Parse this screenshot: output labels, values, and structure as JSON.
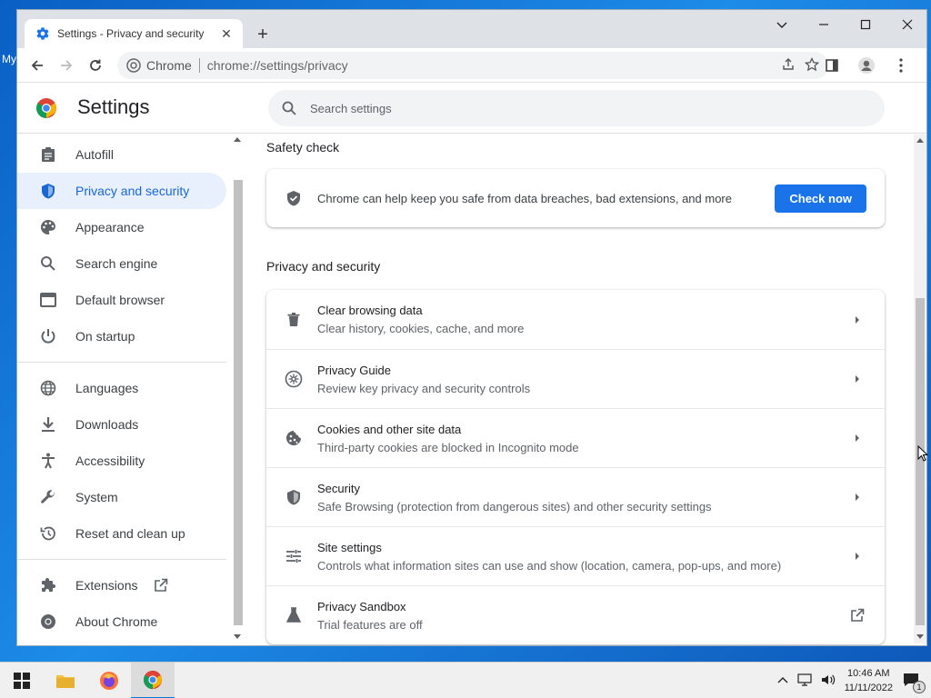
{
  "desktop": {
    "icon_label": "My"
  },
  "tab": {
    "title": "Settings - Privacy and security",
    "close": "✕"
  },
  "newtab_label": "+",
  "omnibox": {
    "site_name": "Chrome",
    "url": "chrome://settings/privacy"
  },
  "header": {
    "title": "Settings",
    "search_placeholder": "Search settings"
  },
  "sidebar": {
    "items": [
      {
        "label": "Autofill",
        "icon": "clipboard-icon"
      },
      {
        "label": "Privacy and security",
        "icon": "shield-icon",
        "active": true
      },
      {
        "label": "Appearance",
        "icon": "palette-icon"
      },
      {
        "label": "Search engine",
        "icon": "search-icon"
      },
      {
        "label": "Default browser",
        "icon": "browser-icon"
      },
      {
        "label": "On startup",
        "icon": "power-icon"
      },
      {
        "label": "Languages",
        "icon": "globe-icon"
      },
      {
        "label": "Downloads",
        "icon": "download-icon"
      },
      {
        "label": "Accessibility",
        "icon": "accessibility-icon"
      },
      {
        "label": "System",
        "icon": "wrench-icon"
      },
      {
        "label": "Reset and clean up",
        "icon": "history-icon"
      },
      {
        "label": "Extensions",
        "icon": "puzzle-icon"
      },
      {
        "label": "About Chrome",
        "icon": "chrome-icon"
      }
    ]
  },
  "safety_check": {
    "title": "Safety check",
    "text": "Chrome can help keep you safe from data breaches, bad extensions, and more",
    "button": "Check now"
  },
  "privacy": {
    "title": "Privacy and security",
    "rows": [
      {
        "title": "Clear browsing data",
        "subtitle": "Clear history, cookies, cache, and more",
        "icon": "trash-icon"
      },
      {
        "title": "Privacy Guide",
        "subtitle": "Review key privacy and security controls",
        "icon": "privacy-guide-icon"
      },
      {
        "title": "Cookies and other site data",
        "subtitle": "Third-party cookies are blocked in Incognito mode",
        "icon": "cookie-icon"
      },
      {
        "title": "Security",
        "subtitle": "Safe Browsing (protection from dangerous sites) and other security settings",
        "icon": "shield-icon"
      },
      {
        "title": "Site settings",
        "subtitle": "Controls what information sites can use and show (location, camera, pop-ups, and more)",
        "icon": "tune-icon"
      },
      {
        "title": "Privacy Sandbox",
        "subtitle": "Trial features are off",
        "icon": "flask-icon"
      }
    ]
  },
  "taskbar": {
    "time": "10:46 AM",
    "date": "11/11/2022",
    "notification_count": "1"
  },
  "colors": {
    "accent": "#1a73e8",
    "active_bg": "#e8f0fe",
    "active_text": "#1967d2"
  }
}
